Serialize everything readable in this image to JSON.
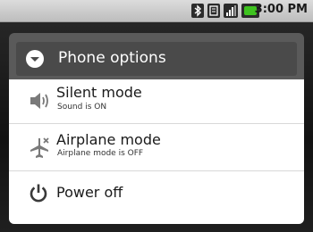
{
  "status_bar": {
    "time": "3:00 PM",
    "icons": [
      "bluetooth-icon",
      "sd-card-icon",
      "signal-icon",
      "battery-icon"
    ],
    "battery_color": "#3ec31f"
  },
  "dialog": {
    "title": "Phone options",
    "title_icon": "dropdown-circle-icon",
    "items": [
      {
        "icon": "speaker-icon",
        "title": "Silent mode",
        "subtitle": "Sound is ON"
      },
      {
        "icon": "airplane-icon",
        "title": "Airplane mode",
        "subtitle": "Airplane mode is OFF"
      },
      {
        "icon": "power-icon",
        "title": "Power off"
      }
    ]
  }
}
